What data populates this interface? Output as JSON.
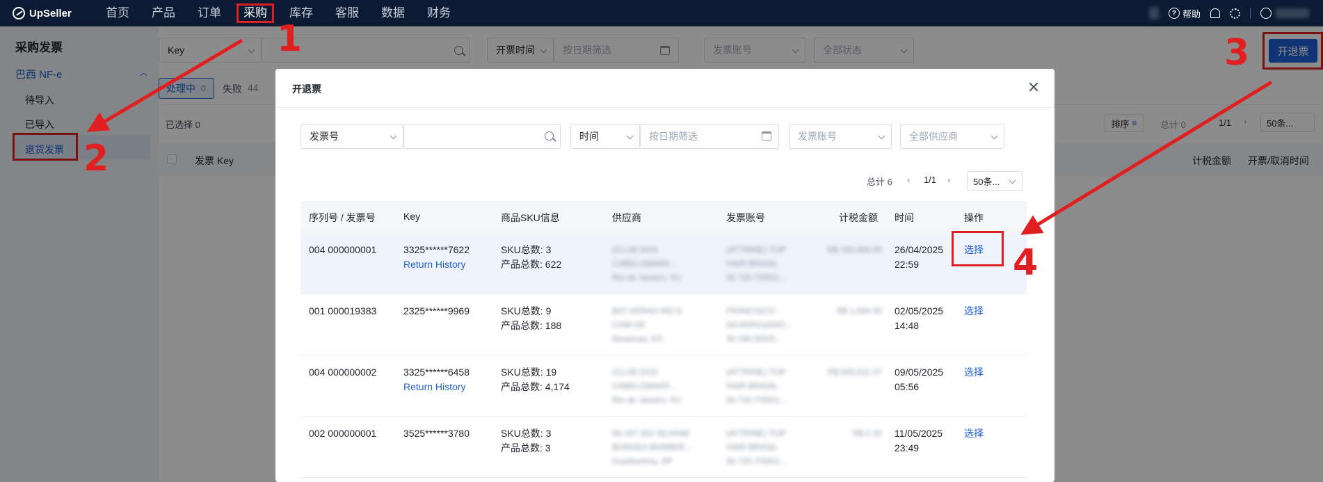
{
  "app": {
    "name": "UpSeller"
  },
  "nav": {
    "items": [
      "首页",
      "产品",
      "订单",
      "采购",
      "库存",
      "客服",
      "数据",
      "财务"
    ],
    "active_index": 3
  },
  "top_right": {
    "help": "帮助"
  },
  "sidebar": {
    "title": "采购发票",
    "group": "巴西 NF-e",
    "items": [
      "待导入",
      "已导入",
      "退货发票"
    ],
    "selected_index": 2
  },
  "main": {
    "key_select": "Key",
    "date_select": "开票时间",
    "date_placeholder": "按日期筛选",
    "account_placeholder": "发票账号",
    "status_placeholder": "全部状态",
    "tab_processing": "处理中",
    "tab_processing_count": "0",
    "tab_failed": "失败",
    "tab_failed_count": "44",
    "selected_text": "已选择 0",
    "sort_label": "排序",
    "total": "总计 0",
    "page": "1/1",
    "page_size": "50条...",
    "col_invoice_key": "发票 Key",
    "col_amount": "计税金额",
    "col_time": "开票/取消时间",
    "issue_button": "开退票"
  },
  "modal": {
    "title": "开退票",
    "invoice_select": "发票号",
    "time_select": "时间",
    "date_placeholder": "按日期筛选",
    "account_placeholder": "发票账号",
    "supplier_placeholder": "全部供应商",
    "total": "总计 6",
    "page": "1/1",
    "page_size": "50条...",
    "columns": [
      "序列号 / 发票号",
      "Key",
      "商品SKU信息",
      "供应商",
      "发票账号",
      "计税金额",
      "时间",
      "操作"
    ],
    "rows": [
      {
        "serial": "004 000000001",
        "key": "3325******7622",
        "history": "Return History",
        "sku": "SKU总数: 3",
        "qty": "产品总数: 622",
        "supplier": [
          "(CLUB DOS",
          "CABELO(MARI...",
          "Rio de Janeiro, RJ"
        ],
        "account": [
          "(ATTRINE) TOP",
          "HAIR BRASIL",
          "30.720.7/0001..."
        ],
        "amount": "R$ 193,460.00",
        "date": "26/04/2025",
        "time": "22:59",
        "action": "选择"
      },
      {
        "serial": "001 000019383",
        "key": "2325******9969",
        "history": "",
        "sku": "SKU总数: 9",
        "qty": "产品总数: 188",
        "supplier": [
          "BIO VERAO IND E",
          "COM DE",
          "Itaraúnas, ES"
        ],
        "account": [
          "FRANCISCO",
          "SILVERIO(ANO...",
          "30.190.505/0..."
        ],
        "amount": "R$ 1,064.40",
        "date": "02/05/2025",
        "time": "14:48",
        "action": "选择"
      },
      {
        "serial": "004 000000002",
        "key": "3325******6458",
        "history": "Return History",
        "sku": "SKU总数: 19",
        "qty": "产品总数: 4,174",
        "supplier": [
          "(CLUB DOS",
          "CABELO(MARI...",
          "Rio de Janeiro, RJ"
        ],
        "account": [
          "(ATTRINE) TOP",
          "HAIR BRASIL",
          "30.720.7/0001..."
        ],
        "amount": "R$ 500,611.07",
        "date": "09/05/2025",
        "time": "05:56",
        "action": "选择"
      },
      {
        "serial": "002 000000001",
        "key": "3525******3780",
        "history": "",
        "sku": "SKU总数: 3",
        "qty": "产品总数: 3",
        "supplier": [
          "06.197.302 SILVANE",
          "BORGES BARBER...",
          "Guaíba/Ana, SP"
        ],
        "account": [
          "(ATTRINE) TOP",
          "HAIR BRASIL",
          "30.720.7/0001..."
        ],
        "amount": "R$ 2.32",
        "date": "11/05/2025",
        "time": "23:49",
        "action": "选择"
      }
    ]
  },
  "annotations": {
    "step1": "1",
    "step2": "2",
    "step3": "3",
    "step4": "4"
  },
  "colors": {
    "primary": "#1f5fd6",
    "annotation": "#e02020",
    "nav_bg": "#0c1b33"
  }
}
